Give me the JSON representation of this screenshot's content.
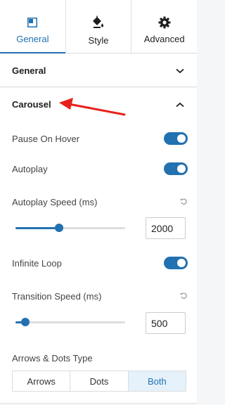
{
  "tabs": [
    {
      "label": "General",
      "icon": "layout-icon"
    },
    {
      "label": "Style",
      "icon": "paint-bucket-icon"
    },
    {
      "label": "Advanced",
      "icon": "gear-icon"
    }
  ],
  "panels": {
    "general": {
      "title": "General"
    },
    "carousel": {
      "title": "Carousel"
    }
  },
  "carousel": {
    "pause_on_hover": {
      "label": "Pause On Hover",
      "on": true
    },
    "autoplay": {
      "label": "Autoplay",
      "on": true
    },
    "autoplay_speed": {
      "label": "Autoplay Speed (ms)",
      "value": "2000",
      "slider_fraction": 0.4
    },
    "infinite_loop": {
      "label": "Infinite Loop",
      "on": true
    },
    "transition_speed": {
      "label": "Transition Speed (ms)",
      "value": "500",
      "slider_fraction": 0.09
    },
    "arrows_dots": {
      "label": "Arrows & Dots Type",
      "options": [
        "Arrows",
        "Dots",
        "Both"
      ],
      "selected": "Both"
    }
  },
  "colors": {
    "accent": "#2271b1",
    "annotation_arrow": "#e8201a"
  }
}
